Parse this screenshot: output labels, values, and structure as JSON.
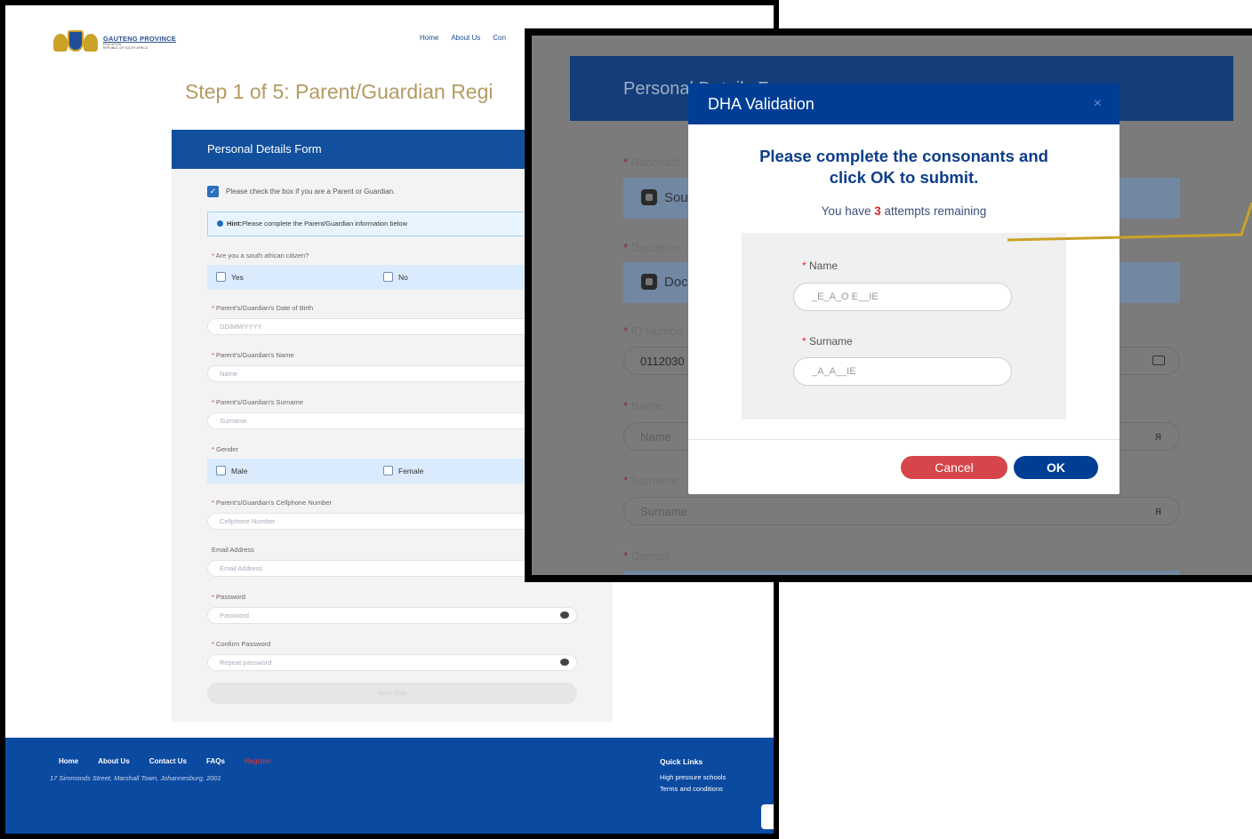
{
  "back": {
    "logo": {
      "title": "GAUTENG PROVINCE",
      "sub1": "EDUCATION",
      "sub2": "REPUBLIC OF SOUTH AFRICA"
    },
    "nav": [
      "Home",
      "About Us",
      "Con"
    ],
    "step_title": "Step 1 of 5: Parent/Guardian Regi",
    "form_title": "Personal Details Form",
    "parent_check": "Please check the box if you are a Parent or Guardian.",
    "hint_bold": "Hint:",
    "hint_text": "Please complete the Parent/Guardian information below",
    "citizen_label": "Are you a south african citizen?",
    "yes": "Yes",
    "no": "No",
    "dob_label": "Parent's/Guardian's Date of Birth",
    "dob_placeholder": "DD/MM/YYYY",
    "name_label": "Parent's/Guardian's Name",
    "name_placeholder": "Name",
    "surname_label": "Parent's/Guardian's Surname",
    "surname_placeholder": "Surname",
    "gender_label": "Gender",
    "male": "Male",
    "female": "Female",
    "cell_label": "Parent's/Guardian's Cellphone Number",
    "cell_placeholder": "Cellphone Number",
    "email_label": "Email Address",
    "email_placeholder": "Email Address",
    "password_label": "Password",
    "password_placeholder": "Password",
    "confirm_label": "Confirm Password",
    "confirm_placeholder": "Repeat password",
    "submit_label": "Next Step",
    "footer": {
      "links": [
        "Home",
        "About Us",
        "Contact Us",
        "FAQs"
      ],
      "register": "Register",
      "address": "17 Simmonds Street, Marshall Town, Johannesburg, 2001",
      "quick_title": "Quick Links",
      "quick_links": [
        "High pressure schools",
        "Terms and conditions"
      ]
    }
  },
  "zoom": {
    "header": "Personal Details F",
    "nationality_label": "Nationalit",
    "nationality_value": "Sout",
    "document_label": "Documen",
    "document_value": "Doc",
    "id_label": "ID Numbe",
    "id_value": "0112030",
    "name_label": "Name",
    "name_placeholder": "Name",
    "surname_label": "Surname",
    "surname_placeholder": "Surname",
    "gender_label": "Gender"
  },
  "modal": {
    "title": "DHA Validation",
    "close": "×",
    "heading_line1": "Please complete the consonants and",
    "heading_line2": "click OK to submit.",
    "attempts_prefix": "You have ",
    "attempts_count": "3",
    "attempts_suffix": " attempts remaining",
    "name_label": "Name",
    "name_value": "_E_A_O E__IE",
    "surname_label": "Surname",
    "surname_value": "_A_A__IE",
    "cancel": "Cancel",
    "ok": "OK"
  },
  "colors": {
    "brand_blue": "#003e95",
    "cancel_red": "#d5454a",
    "title_gold": "#b49a62",
    "callout": "#c9a227"
  }
}
